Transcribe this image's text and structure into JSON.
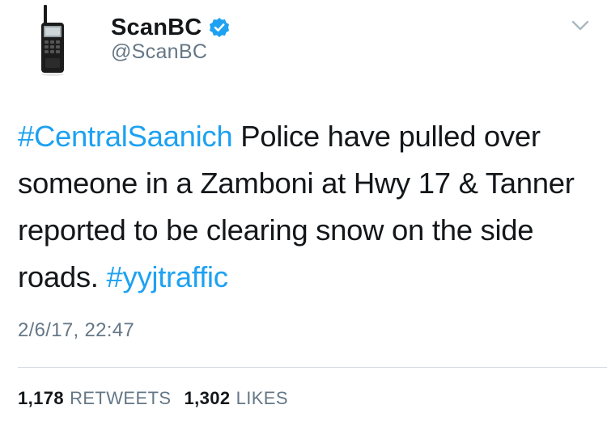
{
  "account": {
    "display_name": "ScanBC",
    "handle": "@ScanBC",
    "verified": true,
    "avatar_icon": "police-scanner-radio-icon"
  },
  "menu": {
    "icon": "chevron-down-icon"
  },
  "tweet": {
    "hashtag_1": "#CentralSaanich",
    "text": " Police have pulled over someone in a Zamboni at Hwy 17 & Tanner reported to be clearing snow on the side roads. ",
    "hashtag_2": "#yyjtraffic",
    "timestamp": "2/6/17, 22:47"
  },
  "stats": {
    "retweets_count": "1,178",
    "retweets_label": "RETWEETS",
    "likes_count": "1,302",
    "likes_label": "LIKES"
  },
  "colors": {
    "link": "#1da1f2",
    "secondary_text": "#657786",
    "primary_text": "#14171a",
    "divider": "#d6dde3"
  }
}
